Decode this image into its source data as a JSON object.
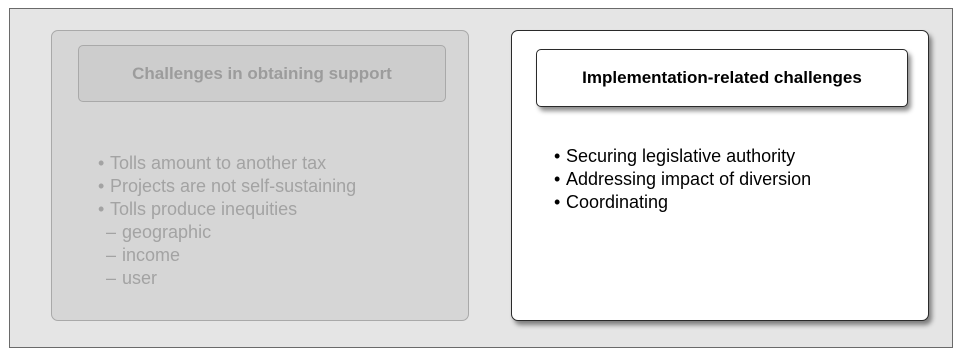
{
  "left_panel": {
    "title": "Challenges in obtaining support",
    "items": [
      "Tolls amount to another tax",
      "Projects are not self-sustaining",
      "Tolls produce inequities"
    ],
    "sub_items": [
      "geographic",
      "income",
      "user"
    ]
  },
  "right_panel": {
    "title": "Implementation-related challenges",
    "items": [
      "Securing legislative authority",
      "Addressing impact of diversion",
      "Coordinating"
    ]
  },
  "glyphs": {
    "bullet": "•",
    "dash": "–"
  },
  "colors": {
    "frame_bg": "#e5e5e5",
    "dimmed_panel_bg": "#d6d6d6",
    "dimmed_text": "#a3a3a3",
    "active_panel_bg": "#ffffff",
    "active_text": "#000000"
  }
}
